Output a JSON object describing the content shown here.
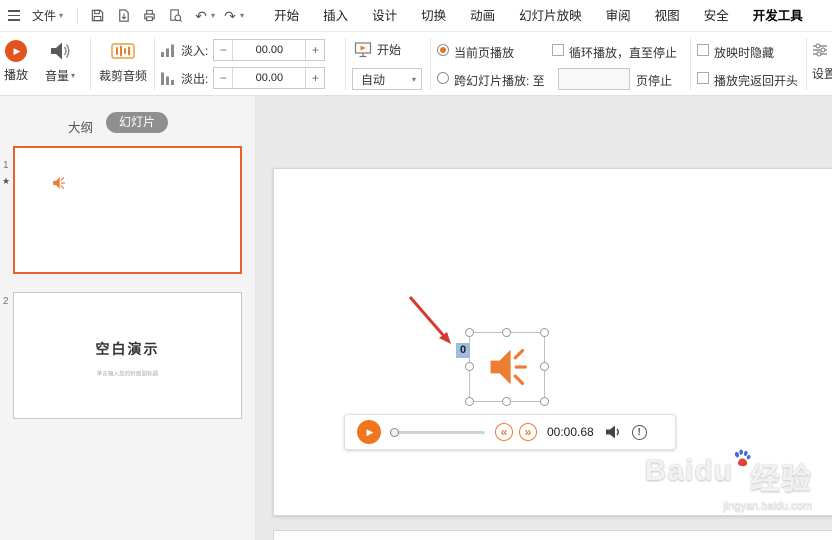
{
  "icons": {
    "play": "▶",
    "skip_back": "«",
    "skip_forward": "»",
    "caret_down": "▾",
    "minus": "−",
    "plus": "+",
    "exclaim": "!",
    "star": "★",
    "undo": "↶",
    "redo": "↷"
  },
  "colors": {
    "accent_orange": "#e8622a",
    "player_orange": "#f0751e",
    "arrow_red": "#d43a2f",
    "selection_blue": "#9fbcdc"
  },
  "menubar": {
    "file": "文件",
    "tabs": [
      "开始",
      "插入",
      "设计",
      "切换",
      "动画",
      "幻灯片放映",
      "审阅",
      "视图",
      "安全",
      "开发工具"
    ]
  },
  "ribbon": {
    "play": "播放",
    "volume": "音量",
    "trim": "裁剪音频",
    "fade_in": "淡入:",
    "fade_in_value": "00.00",
    "fade_out": "淡出:",
    "fade_out_value": "00.00",
    "start": "开始",
    "start_mode": "自动",
    "current_page": "当前页播放",
    "across_slides": "跨幻灯片播放: 至",
    "page_stop": "页停止",
    "loop": "循环播放，直至停止",
    "hide": "放映时隐藏",
    "rewind": "播放完返回开头",
    "settings": "设置"
  },
  "sidebar": {
    "outline": "大纲",
    "slides_tab": "幻灯片",
    "slide1_num": "1",
    "slide2_num": "2",
    "slide2_title": "空白演示",
    "slide2_subtitle": "单击输入您的封面副标题"
  },
  "canvas": {
    "audio_order": "0",
    "time": "00:00.68"
  },
  "watermark": {
    "brand": "Baidu",
    "brand_cn": "经验",
    "url": "jingyan.baidu.com"
  }
}
